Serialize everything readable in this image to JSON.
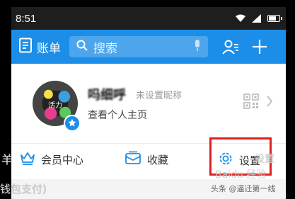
{
  "status_bar": {
    "time": "8:51",
    "battery_level": 0.8
  },
  "header": {
    "bill_label": "账单",
    "search_placeholder": "搜索",
    "accent_color": "#1c8ee8"
  },
  "profile": {
    "nickname": "吗细呼",
    "nickname_placeholder": "未设置昵称",
    "view_home_label": "查看个人主页",
    "avatar_text": "活力"
  },
  "menu": {
    "items": [
      {
        "label": "会员中心",
        "icon": "crown-icon"
      },
      {
        "label": "收藏",
        "icon": "favorites-icon"
      },
      {
        "label": "设置",
        "icon": "settings-gear-icon"
      }
    ],
    "highlight_color": "#e02020"
  },
  "overlays": {
    "left_fragment": "羊",
    "bottom_fragment": "钱包支付)",
    "right_fragment": "力",
    "right_fragment2": "设置",
    "watermark_baidu": "Baidu 经验",
    "watermark_credit": "头条 @逼迁第一线"
  }
}
